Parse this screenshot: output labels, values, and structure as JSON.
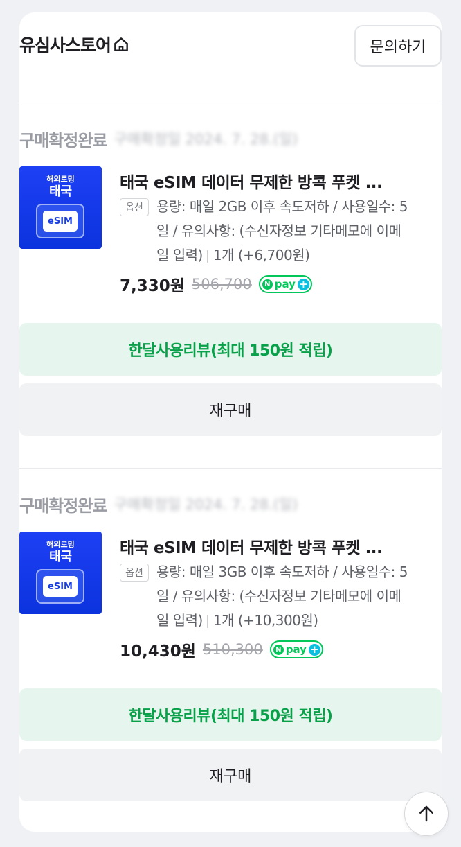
{
  "store": {
    "name": "유심사스토어",
    "home_icon": "home-icon",
    "inquiry_label": "문의하기"
  },
  "orders": [
    {
      "status": "구매확정완료",
      "confirm_date": "구매확정일 2024. 7. 28.(일)",
      "thumb_sub": "해외로밍",
      "thumb_main": "태국",
      "thumb_chip": "eSIM",
      "title": "태국 eSIM 데이터 무제한 방콕 푸켓 ...",
      "option_badge": "옵션",
      "option_text": "용량: 매일 2GB 이후 속도저하 / 사용일수: 5일 / 유의사항: (수신자정보 기타메모에 이메일 입력)",
      "quantity_price": "1개 (+6,700원)",
      "price": "7,330원",
      "original_price": "506,700",
      "npay_text": "pay",
      "review_label": "한달사용리뷰(최대 150원 적립)",
      "rebuy_label": "재구매"
    },
    {
      "status": "구매확정완료",
      "confirm_date": "구매확정일 2024. 7. 28.(일)",
      "thumb_sub": "해외로밍",
      "thumb_main": "태국",
      "thumb_chip": "eSIM",
      "title": "태국 eSIM 데이터 무제한 방콕 푸켓 ...",
      "option_badge": "옵션",
      "option_text": "용량: 매일 3GB 이후 속도저하 / 사용일수: 5일 / 유의사항: (수신자정보 기타메모에 이메일 입력)",
      "quantity_price": "1개 (+10,300원)",
      "price": "10,430원",
      "original_price": "510,300",
      "npay_text": "pay",
      "review_label": "한달사용리뷰(최대 150원 적립)",
      "rebuy_label": "재구매"
    }
  ],
  "colors": {
    "accent_green": "#09a04a",
    "npay_green": "#03c75a",
    "thumb_blue": "#1e40f5"
  }
}
